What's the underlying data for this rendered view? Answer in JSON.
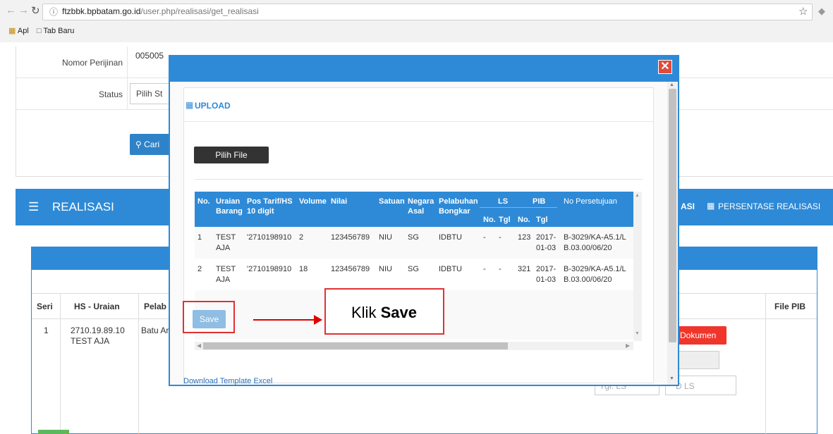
{
  "browser": {
    "url_host": "ftzbbk.bpbatam.go.id",
    "url_path": "/user.php/realisasi/get_realisasi",
    "bookmarks": [
      "Apl",
      "Tab Baru"
    ]
  },
  "form": {
    "nomor_label": "Nomor Perijinan",
    "nomor_value": "005005",
    "status_label": "Status",
    "status_value": "Pilih St",
    "cari_label": "Cari"
  },
  "realisasi": {
    "title": "REALISASI",
    "right_tab_partial": "ASI",
    "persentase_label": "PERSENTASE REALISASI",
    "columns": [
      "Seri",
      "HS - Uraian",
      "Pelab",
      "File PIB"
    ],
    "row": {
      "seri": "1",
      "hs": "2710.19.89.10",
      "uraian": "TEST AJA",
      "pelab": "Batu Ar"
    },
    "dokumen_btn": "Dokumen",
    "ls_placeholder": "D LS",
    "ls_left_placeholder": "Tgl. LS"
  },
  "modal": {
    "title": "UPLOAD",
    "pilih_file": "Pilih File",
    "save": "Save",
    "download_template": "Download Template Excel",
    "headers": {
      "no": "No.",
      "uraian": "Uraian Barang",
      "pos_tarif": "Pos Tarif/HS 10 digit",
      "volume": "Volume",
      "nilai": "Nilai",
      "satuan": "Satuan",
      "negara": "Negara Asal",
      "pelabuhan": "Pelabuhan Bongkar",
      "ls": "LS",
      "pib": "PIB",
      "no_persetujuan": "No Persetujuan",
      "ls_no": "No.",
      "ls_tgl": "Tgl",
      "pib_no": "No.",
      "pib_tgl": "Tgl"
    },
    "rows": [
      {
        "no": "1",
        "uraian": "TEST AJA",
        "pos": "'2710198910",
        "volume": "2",
        "nilai": "123456789",
        "satuan": "NIU",
        "negara": "SG",
        "pelabuhan": "IDBTU",
        "ls_no": "-",
        "ls_tgl": "-",
        "pib_no": "123",
        "pib_tgl": "2017-01-03",
        "persetujuan": "B-3029/KA-A5.1/LB.03.00/06/20"
      },
      {
        "no": "2",
        "uraian": "TEST AJA",
        "pos": "'2710198910",
        "volume": "18",
        "nilai": "123456789",
        "satuan": "NIU",
        "negara": "SG",
        "pelabuhan": "IDBTU",
        "ls_no": "-",
        "ls_tgl": "-",
        "pib_no": "321",
        "pib_tgl": "2017-01-03",
        "persetujuan": "B-3029/KA-A5.1/LB.03.00/06/20"
      }
    ]
  },
  "annotation": {
    "prefix": "Klik",
    "bold": "Save"
  },
  "colors": {
    "accent": "#2e8ad6",
    "danger": "#e24a3a",
    "annotation": "#e03232"
  }
}
